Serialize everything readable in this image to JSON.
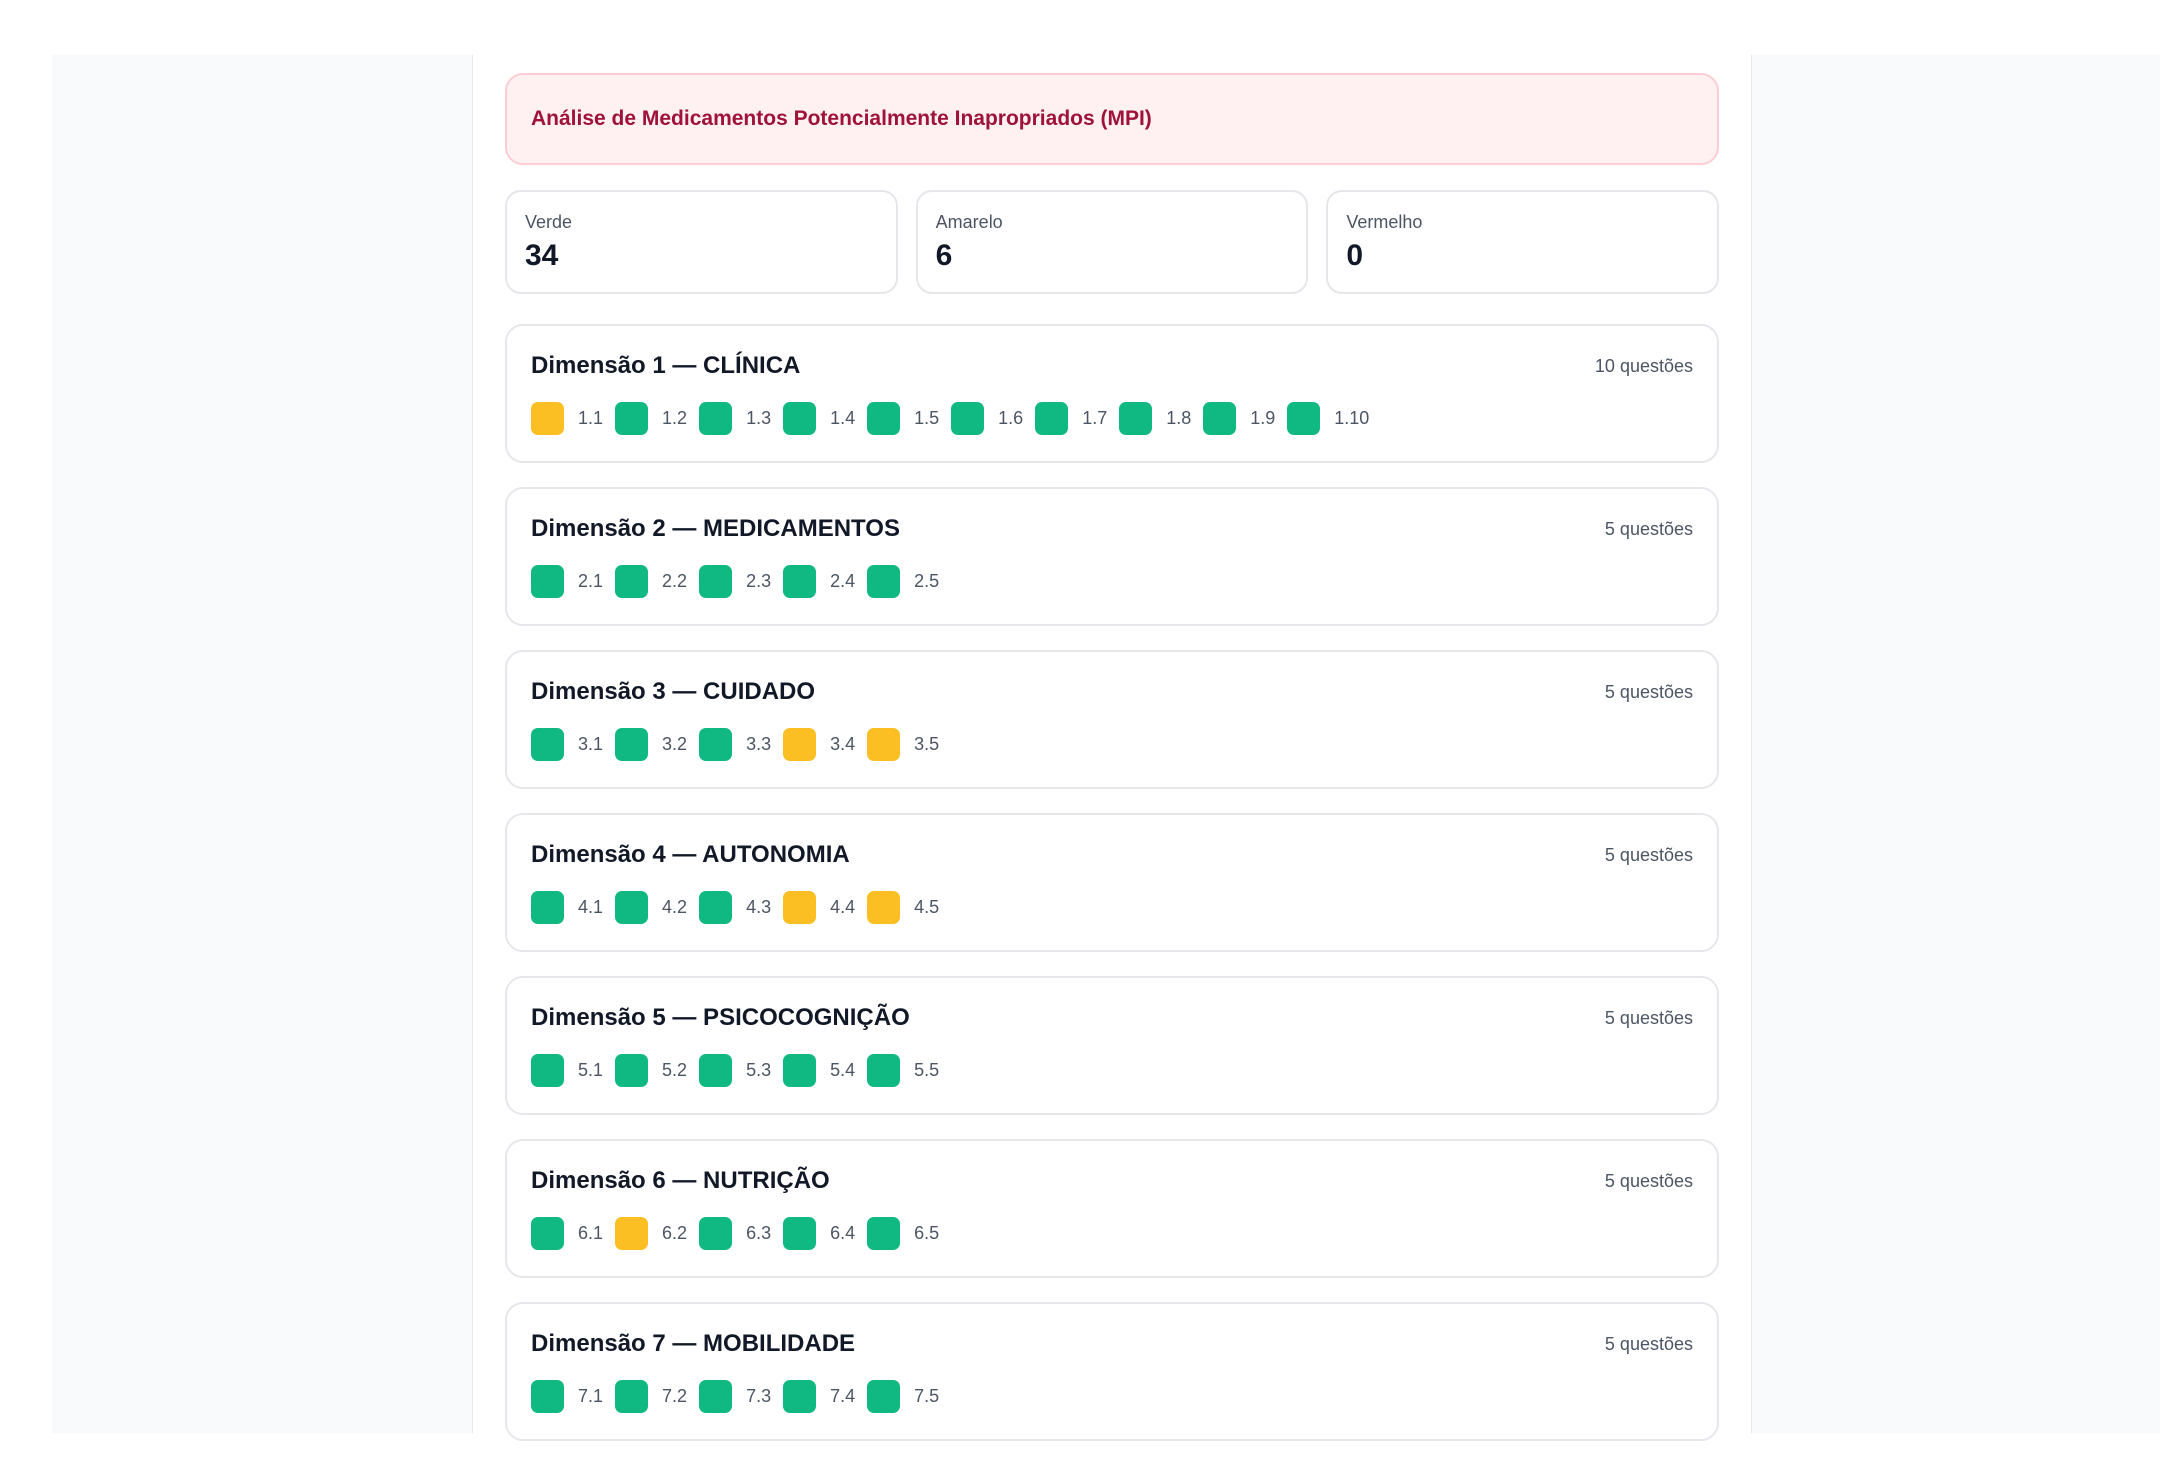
{
  "alert": {
    "title": "Análise de Medicamentos Potencialmente Inapropriados (MPI)"
  },
  "summary": [
    {
      "label": "Verde",
      "value": "34"
    },
    {
      "label": "Amarelo",
      "value": "6"
    },
    {
      "label": "Vermelho",
      "value": "0"
    }
  ],
  "colors": {
    "green": "#10b981",
    "amber": "#fbbf24",
    "alert_text": "#9f1239"
  },
  "dimensions": [
    {
      "title": "Dimensão 1 — CLÍNICA",
      "count": "10 questões",
      "questions": [
        {
          "label": "1.1",
          "status": "amber"
        },
        {
          "label": "1.2",
          "status": "green"
        },
        {
          "label": "1.3",
          "status": "green"
        },
        {
          "label": "1.4",
          "status": "green"
        },
        {
          "label": "1.5",
          "status": "green"
        },
        {
          "label": "1.6",
          "status": "green"
        },
        {
          "label": "1.7",
          "status": "green"
        },
        {
          "label": "1.8",
          "status": "green"
        },
        {
          "label": "1.9",
          "status": "green"
        },
        {
          "label": "1.10",
          "status": "green"
        }
      ]
    },
    {
      "title": "Dimensão 2 — MEDICAMENTOS",
      "count": "5 questões",
      "questions": [
        {
          "label": "2.1",
          "status": "green"
        },
        {
          "label": "2.2",
          "status": "green"
        },
        {
          "label": "2.3",
          "status": "green"
        },
        {
          "label": "2.4",
          "status": "green"
        },
        {
          "label": "2.5",
          "status": "green"
        }
      ]
    },
    {
      "title": "Dimensão 3 — CUIDADO",
      "count": "5 questões",
      "questions": [
        {
          "label": "3.1",
          "status": "green"
        },
        {
          "label": "3.2",
          "status": "green"
        },
        {
          "label": "3.3",
          "status": "green"
        },
        {
          "label": "3.4",
          "status": "amber"
        },
        {
          "label": "3.5",
          "status": "amber"
        }
      ]
    },
    {
      "title": "Dimensão 4 — AUTONOMIA",
      "count": "5 questões",
      "questions": [
        {
          "label": "4.1",
          "status": "green"
        },
        {
          "label": "4.2",
          "status": "green"
        },
        {
          "label": "4.3",
          "status": "green"
        },
        {
          "label": "4.4",
          "status": "amber"
        },
        {
          "label": "4.5",
          "status": "amber"
        }
      ]
    },
    {
      "title": "Dimensão 5 — PSICOCOGNIÇÃO",
      "count": "5 questões",
      "questions": [
        {
          "label": "5.1",
          "status": "green"
        },
        {
          "label": "5.2",
          "status": "green"
        },
        {
          "label": "5.3",
          "status": "green"
        },
        {
          "label": "5.4",
          "status": "green"
        },
        {
          "label": "5.5",
          "status": "green"
        }
      ]
    },
    {
      "title": "Dimensão 6 — NUTRIÇÃO",
      "count": "5 questões",
      "questions": [
        {
          "label": "6.1",
          "status": "green"
        },
        {
          "label": "6.2",
          "status": "amber"
        },
        {
          "label": "6.3",
          "status": "green"
        },
        {
          "label": "6.4",
          "status": "green"
        },
        {
          "label": "6.5",
          "status": "green"
        }
      ]
    },
    {
      "title": "Dimensão 7 — MOBILIDADE",
      "count": "5 questões",
      "questions": [
        {
          "label": "7.1",
          "status": "green"
        },
        {
          "label": "7.2",
          "status": "green"
        },
        {
          "label": "7.3",
          "status": "green"
        },
        {
          "label": "7.4",
          "status": "green"
        },
        {
          "label": "7.5",
          "status": "green"
        }
      ]
    }
  ]
}
